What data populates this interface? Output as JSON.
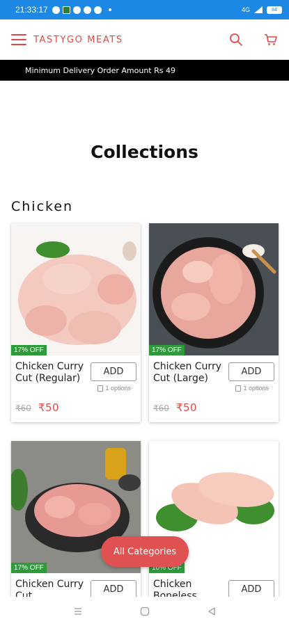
{
  "status_bar": {
    "time": "21:33:17",
    "right_text": "4G",
    "battery": "84"
  },
  "header": {
    "brand": "TASTYGO MEATS"
  },
  "banner": {
    "text": "Minimum Delivery Order Amount Rs 49"
  },
  "page": {
    "title": "Collections",
    "section": "Chicken"
  },
  "products": [
    {
      "name": "Chicken Curry Cut (Regular)",
      "badge": "17% OFF",
      "add_label": "ADD",
      "options": "1 options",
      "old_price": "₹60",
      "price": "₹50"
    },
    {
      "name": "Chicken Curry Cut (Large)",
      "badge": "17% OFF",
      "add_label": "ADD",
      "options": "1 options",
      "old_price": "₹60",
      "price": "₹50"
    },
    {
      "name": "Chicken Curry Cut",
      "badge": "17% OFF",
      "add_label": "ADD"
    },
    {
      "name": "Chicken Boneless",
      "badge": "10% OFF",
      "add_label": "ADD"
    }
  ],
  "floating": {
    "label": "All Categories"
  },
  "colors": {
    "accent": "#e04848",
    "status_bar": "#1e88e5",
    "badge": "#2e9a3a"
  }
}
